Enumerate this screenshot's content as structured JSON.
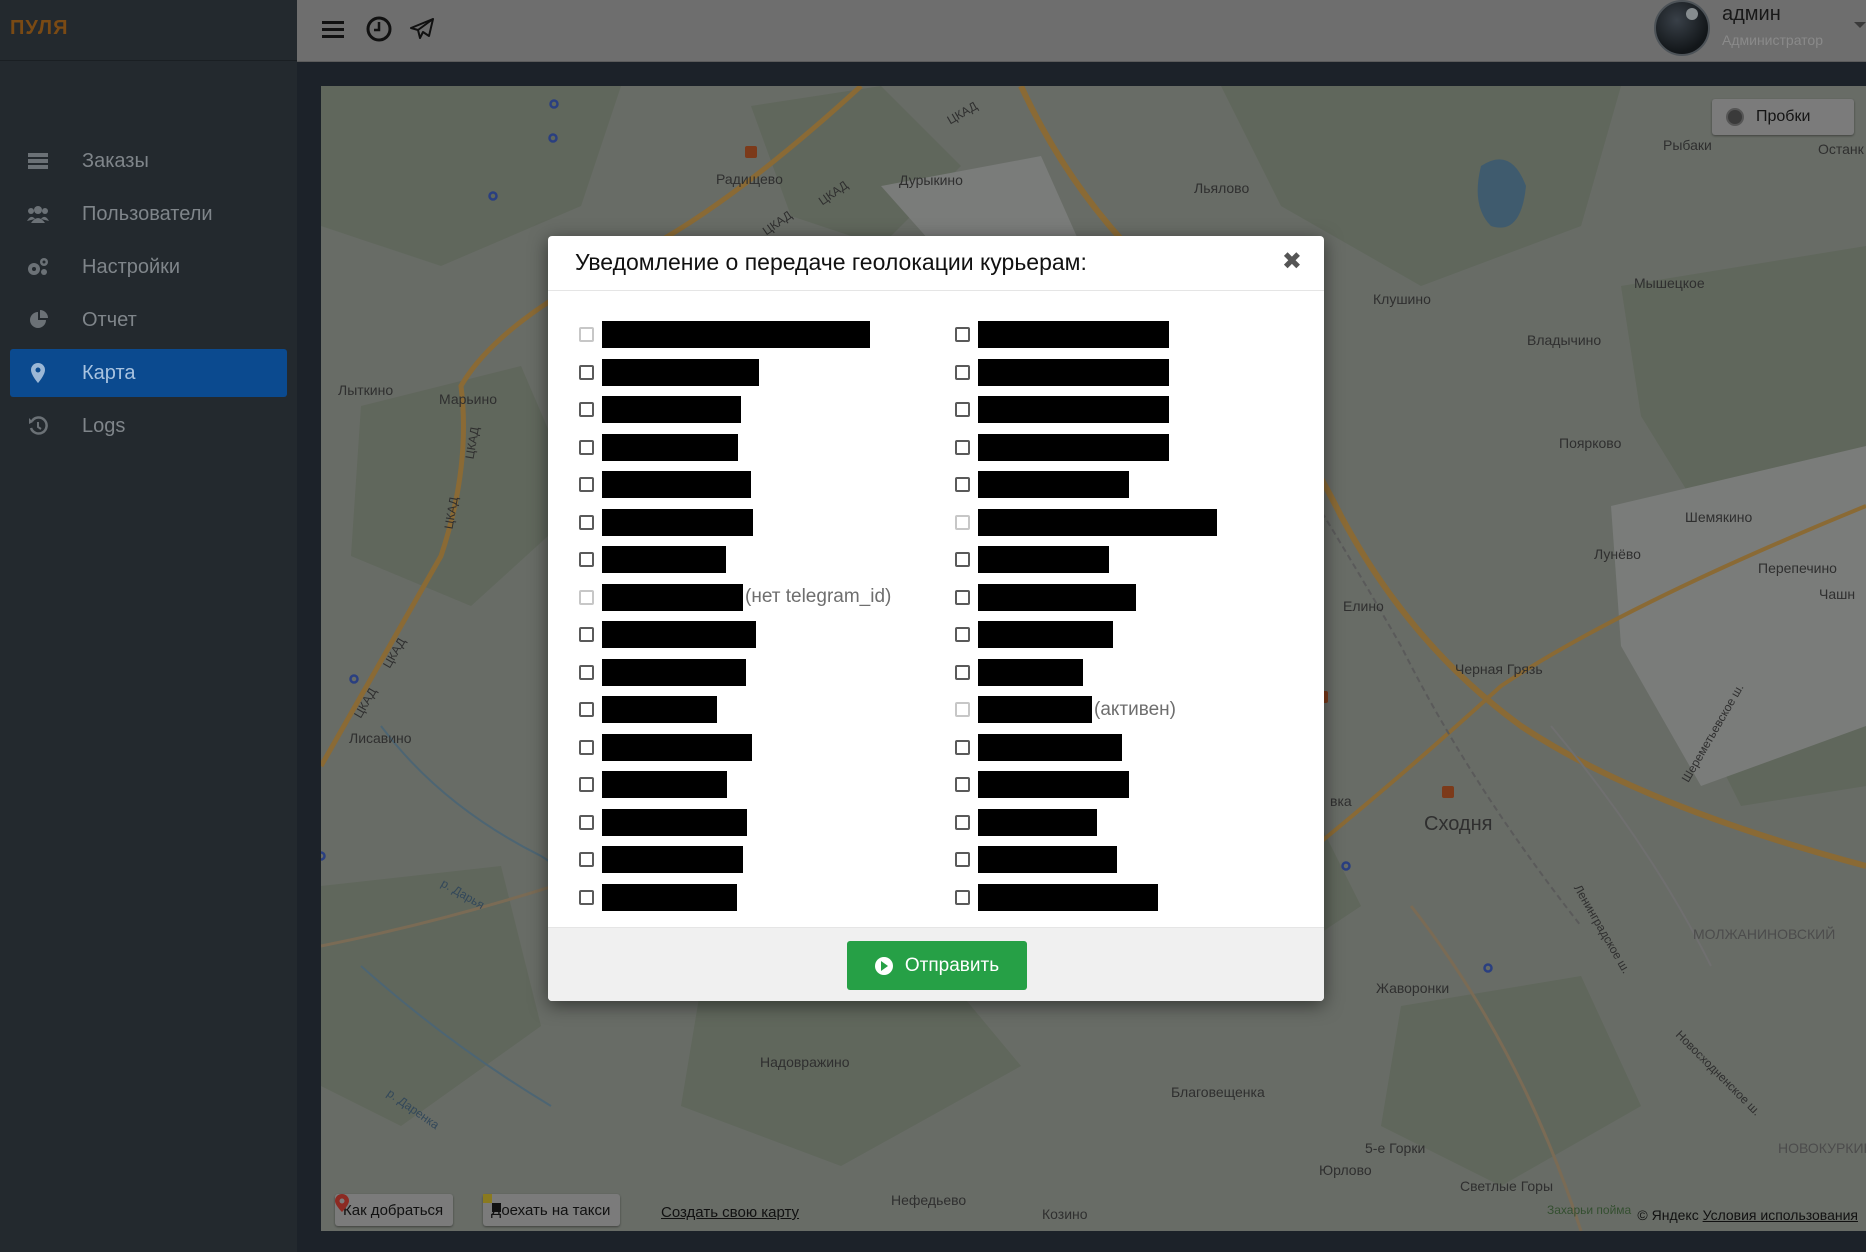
{
  "brand": "ПУЛЯ",
  "sidebar": {
    "items": [
      {
        "label": "Заказы",
        "icon": "list-icon",
        "active": false
      },
      {
        "label": "Пользователи",
        "icon": "users-icon",
        "active": false
      },
      {
        "label": "Настройки",
        "icon": "gears-icon",
        "active": false
      },
      {
        "label": "Отчет",
        "icon": "pie-chart-icon",
        "active": false
      },
      {
        "label": "Карта",
        "icon": "map-marker-icon",
        "active": true
      },
      {
        "label": "Logs",
        "icon": "history-icon",
        "active": false
      }
    ]
  },
  "topbar": {
    "icons": [
      "menu-icon",
      "clock-icon",
      "paper-plane-icon"
    ],
    "user": {
      "name": "админ",
      "role": "Администратор"
    }
  },
  "map": {
    "traffic_button": "Пробки",
    "route_button": "Как добраться",
    "taxi_button": "Доехать на такси",
    "create_map_link": "Создать свою карту",
    "copyright": "© Яндекс",
    "terms_link": "Условия использования",
    "labels": {
      "radishchevo": "Радищево",
      "durykino": "Дурыкино",
      "lyalovo": "Льялово",
      "rybaki": "Рыбаки",
      "ostankino": "Останк",
      "mysheckoe": "Мышецкое",
      "klushino": "Клушино",
      "vladychino": "Владычино",
      "lytkino": "Лыткино",
      "marino": "Марьино",
      "poyarkovo": "Поярково",
      "shemyakino": "Шемякино",
      "lunevo": "Лунёво",
      "perepechino": "Перепечино",
      "chashn": "Чашн",
      "elino": "Елино",
      "chernaya_gryaz": "Черная Грязь",
      "lisavino": "Лисавино",
      "skhodnya": "Сходня",
      "molzhaninovsky": "МОЛЖАНИНОВСКИЙ",
      "zhavoronki": "Жаворонки",
      "nadovrazhino": "Надовражино",
      "blagoveshchenka": "Благовещенка",
      "five_gorki": "5-е Горки",
      "novokurkino": "НОВОКУРКИНО",
      "yurlovo": "Юрлово",
      "svetlye_gory": "Светлые Горы",
      "nefedyevo": "Нефедьево",
      "kozino": "Козино",
      "zakhary_poyma": "Захарьи пойма",
      "darya": "р. Дарья",
      "darenka": "р. Даренка",
      "ckad": "ЦКАД",
      "leningradskoe": "Ленинградское ш.",
      "sheremetyevskoe": "Шереметьевское ш.",
      "novoskhodnenskoe": "Новосходненское ш.",
      "vka": "вка"
    }
  },
  "modal": {
    "title": "Уведомление о передаче геолокации курьерам:",
    "close": "✖",
    "left_column": [
      {
        "width": 268,
        "disabled": true,
        "note": ""
      },
      {
        "width": 157,
        "disabled": false,
        "note": ""
      },
      {
        "width": 139,
        "disabled": false,
        "note": ""
      },
      {
        "width": 136,
        "disabled": false,
        "note": ""
      },
      {
        "width": 149,
        "disabled": false,
        "note": ""
      },
      {
        "width": 151,
        "disabled": false,
        "note": ""
      },
      {
        "width": 124,
        "disabled": false,
        "note": ""
      },
      {
        "width": 141,
        "disabled": true,
        "note": "(нет telegram_id)"
      },
      {
        "width": 154,
        "disabled": false,
        "note": ""
      },
      {
        "width": 144,
        "disabled": false,
        "note": ""
      },
      {
        "width": 115,
        "disabled": false,
        "note": ""
      },
      {
        "width": 150,
        "disabled": false,
        "note": ""
      },
      {
        "width": 125,
        "disabled": false,
        "note": ""
      },
      {
        "width": 145,
        "disabled": false,
        "note": ""
      },
      {
        "width": 141,
        "disabled": false,
        "note": ""
      },
      {
        "width": 135,
        "disabled": false,
        "note": ""
      }
    ],
    "right_column": [
      {
        "width": 191,
        "disabled": false,
        "note": ""
      },
      {
        "width": 191,
        "disabled": false,
        "note": ""
      },
      {
        "width": 191,
        "disabled": false,
        "note": ""
      },
      {
        "width": 191,
        "disabled": false,
        "note": ""
      },
      {
        "width": 151,
        "disabled": false,
        "note": ""
      },
      {
        "width": 239,
        "disabled": true,
        "note": ""
      },
      {
        "width": 131,
        "disabled": false,
        "note": ""
      },
      {
        "width": 158,
        "disabled": false,
        "note": ""
      },
      {
        "width": 135,
        "disabled": false,
        "note": ""
      },
      {
        "width": 105,
        "disabled": false,
        "note": ""
      },
      {
        "width": 114,
        "disabled": true,
        "note": "(активен)"
      },
      {
        "width": 144,
        "disabled": false,
        "note": ""
      },
      {
        "width": 151,
        "disabled": false,
        "note": ""
      },
      {
        "width": 119,
        "disabled": false,
        "note": ""
      },
      {
        "width": 139,
        "disabled": false,
        "note": ""
      },
      {
        "width": 180,
        "disabled": false,
        "note": ""
      }
    ],
    "submit_label": "Отправить"
  }
}
